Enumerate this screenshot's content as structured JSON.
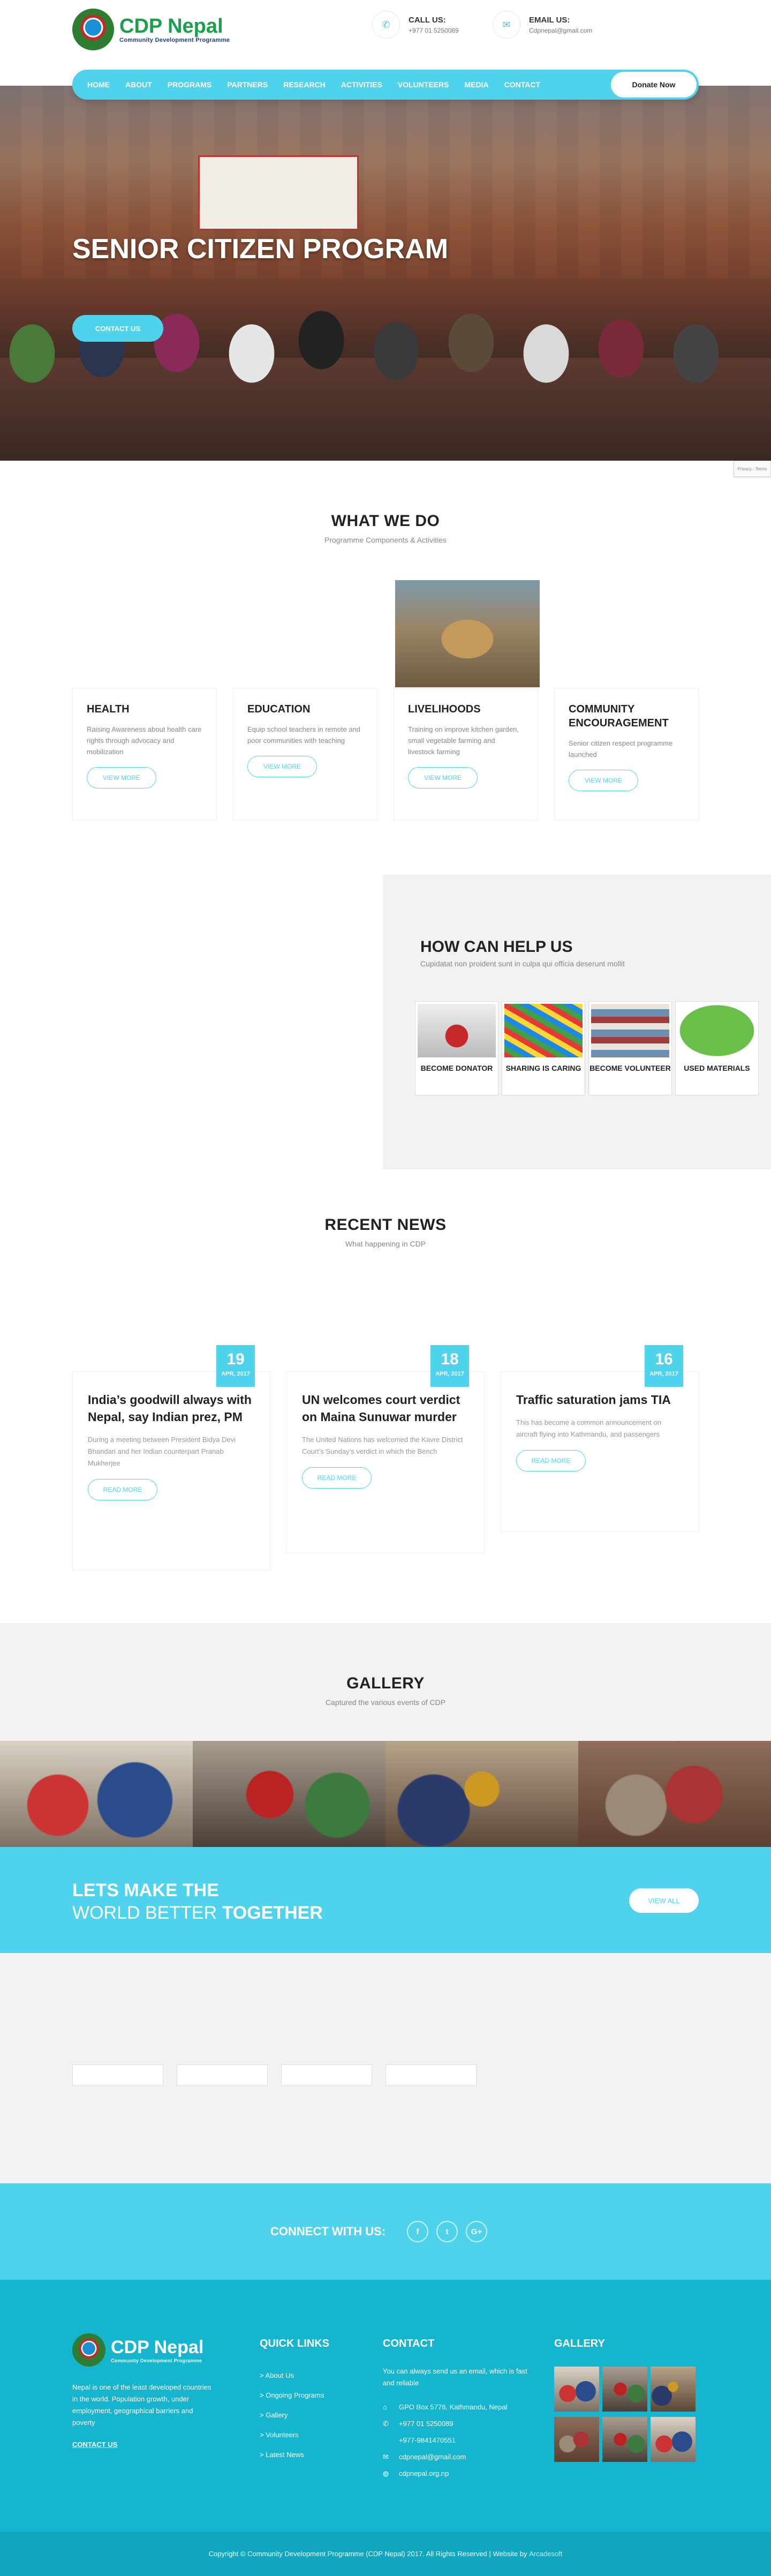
{
  "header": {
    "logo_title": "CDP Nepal",
    "logo_subtitle": "Community Development Programme",
    "call_label": "CALL US:",
    "call_value": "+977 01 5250089",
    "email_label": "EMAIL US:",
    "email_value": "Cdpnepal@gmail.com"
  },
  "nav": {
    "items": [
      "Home",
      "About",
      "Programs",
      "Partners",
      "Research",
      "Activities",
      "Volunteers",
      "Media",
      "Contact"
    ],
    "donate_label": "Donate Now"
  },
  "hero": {
    "title": "Senior Citizen Program",
    "button_label": "Contact Us",
    "recaptcha": "Privacy - Terms"
  },
  "what_we_do": {
    "title": "What We Do",
    "subtitle": "Programme Components & Activities",
    "cards": [
      {
        "title": "Health",
        "text": "Raising Awareness about health care rights through advocacy and mobilization",
        "button": "View More"
      },
      {
        "title": "Education",
        "text": "Equip school teachers in remote and poor communities with teaching",
        "button": "View More"
      },
      {
        "title": "Livelihoods",
        "text": "Training on improve kitchen garden, small vegetable farming and livestock farming",
        "button": "View More"
      },
      {
        "title": "Community Encouragement",
        "text": "Senior citizen respect programme launched",
        "button": "View More"
      }
    ]
  },
  "help": {
    "title": "How Can Help Us",
    "subtitle": "Cupidatat non proident sunt in culpa qui officia deserunt mollit",
    "tiles": [
      {
        "title": "Become Donator"
      },
      {
        "title": "Sharing is caring"
      },
      {
        "title": "Become Volunteer"
      },
      {
        "title": "Used Materials"
      }
    ]
  },
  "news": {
    "title": "Recent News",
    "subtitle": "What happening in CDP",
    "items": [
      {
        "day": "19",
        "month": "APR, 2017",
        "title": "India’s goodwill always with Nepal, say Indian prez, PM",
        "text": "During a meeting between President Bidya Devi Bhandari and her Indian counterpart Pranab Mukherjee",
        "button": "Read More"
      },
      {
        "day": "18",
        "month": "APR, 2017",
        "title": "UN welcomes court verdict on Maina Sunuwar murder",
        "text": "The United Nations has welcomed the Kavre District Court’s Sunday’s verdict in which the Bench",
        "button": "Read More"
      },
      {
        "day": "16",
        "month": "APR, 2017",
        "title": "Traffic saturation jams TIA",
        "text": "This has become a common announcement on aircraft flying into Kathmandu, and passengers",
        "button": "Read More"
      }
    ]
  },
  "gallery": {
    "title": "Gallery",
    "subtitle": "Captured the various events of CDP"
  },
  "cta": {
    "line1": "Lets make the",
    "line2_a": "world better",
    "line2_b": "together",
    "button": "View All"
  },
  "connect": {
    "label": "Connect with us:",
    "facebook": "f",
    "twitter": "t",
    "google": "G+"
  },
  "footer": {
    "logo_title": "CDP Nepal",
    "logo_subtitle": "Community Development Programme",
    "about_text": "Nepal is one of the least developed countries in the world. Population growth, under employment, geographical barriers and poverty",
    "about_link": "Contact Us",
    "quick_links_title": "Quick Links",
    "quick_links": [
      "> About Us",
      "> Ongoing Programs",
      "> Gallery",
      "> Volunteers",
      "> Latest News"
    ],
    "contact_title": "Contact",
    "contact_text": "You can always send us an email, which is fast and reliable",
    "address": "GPO Box 5776, Kathmandu, Nepal",
    "phone1": "+977 01 5250089",
    "phone2": "+977-9841470551",
    "email": "cdpnepal@gmail.com",
    "website": "cdpnepal.org.np",
    "gallery_title": "Gallery",
    "copyright": "Copyright © Community Development Programme (CDP Nepal) 2017. All Rights Reserved | Website by",
    "webby": "Arcadesoft"
  },
  "colors": {
    "accent": "#4fd3ec",
    "footer": "#16b5cf"
  }
}
